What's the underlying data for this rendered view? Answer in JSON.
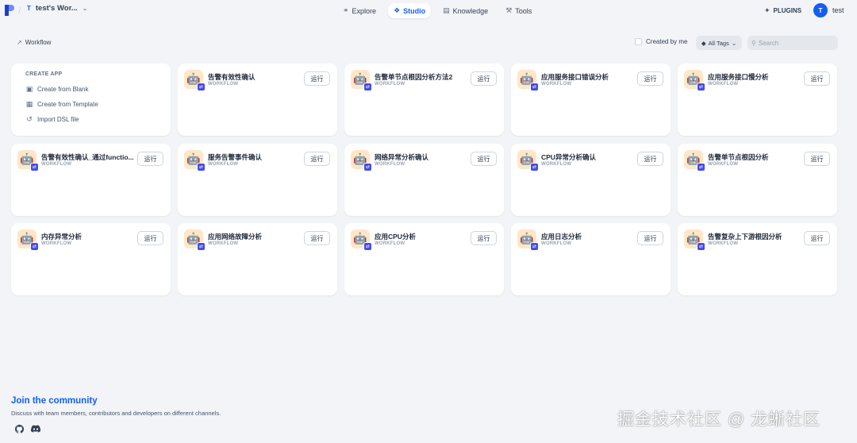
{
  "header": {
    "workspace_letter": "T",
    "workspace_name": "test's Wor...",
    "nav": [
      {
        "label": "Explore",
        "icon": "compass-icon",
        "active": false
      },
      {
        "label": "Studio",
        "icon": "studio-icon",
        "active": true
      },
      {
        "label": "Knowledge",
        "icon": "book-icon",
        "active": false
      },
      {
        "label": "Tools",
        "icon": "tools-icon",
        "active": false
      }
    ],
    "plugins_label": "PLUGINS",
    "avatar_letter": "T",
    "user_name": "test"
  },
  "toolbar": {
    "breadcrumb": "Workflow",
    "created_by_me": "Created by me",
    "all_tags": "All Tags",
    "search_placeholder": "Search"
  },
  "create_app": {
    "title": "CREATE APP",
    "items": [
      {
        "label": "Create from Blank",
        "icon": "file-add-icon"
      },
      {
        "label": "Create from Template",
        "icon": "template-icon"
      },
      {
        "label": "Import DSL file",
        "icon": "import-icon"
      }
    ]
  },
  "apps": [
    {
      "name": "告警有效性确认",
      "type": "WORKFLOW",
      "action": "运行"
    },
    {
      "name": "告警单节点根因分析方法2",
      "type": "WORKFLOW",
      "action": "运行"
    },
    {
      "name": "应用服务接口错误分析",
      "type": "WORKFLOW",
      "action": "运行"
    },
    {
      "name": "应用服务接口慢分析",
      "type": "WORKFLOW",
      "action": "运行"
    },
    {
      "name": "告警有效性确认_通过functio...",
      "type": "WORKFLOW",
      "action": "运行"
    },
    {
      "name": "服务告警事件确认",
      "type": "WORKFLOW",
      "action": "运行"
    },
    {
      "name": "网络异常分析确认",
      "type": "WORKFLOW",
      "action": "运行"
    },
    {
      "name": "CPU异常分析确认",
      "type": "WORKFLOW",
      "action": "运行"
    },
    {
      "name": "告警单节点根因分析",
      "type": "WORKFLOW",
      "action": "运行"
    },
    {
      "name": "内存异常分析",
      "type": "WORKFLOW",
      "action": "运行"
    },
    {
      "name": "应用网络故障分析",
      "type": "WORKFLOW",
      "action": "运行"
    },
    {
      "name": "应用CPU分析",
      "type": "WORKFLOW",
      "action": "运行"
    },
    {
      "name": "应用日志分析",
      "type": "WORKFLOW",
      "action": "运行"
    },
    {
      "name": "告警复杂上下游根因分析",
      "type": "WORKFLOW",
      "action": "运行"
    }
  ],
  "community": {
    "title": "Join the community",
    "description": "Discuss with team members, contributors and developers on different channels.",
    "links": [
      {
        "icon": "github-icon"
      },
      {
        "icon": "discord-icon"
      }
    ]
  },
  "watermark": "掘金技术社区 @ 龙蜥社区",
  "colors": {
    "accent": "#155eef",
    "background": "#f2f4f7",
    "app_icon_bg": "#ffe6c7",
    "badge": "#444ce7"
  }
}
